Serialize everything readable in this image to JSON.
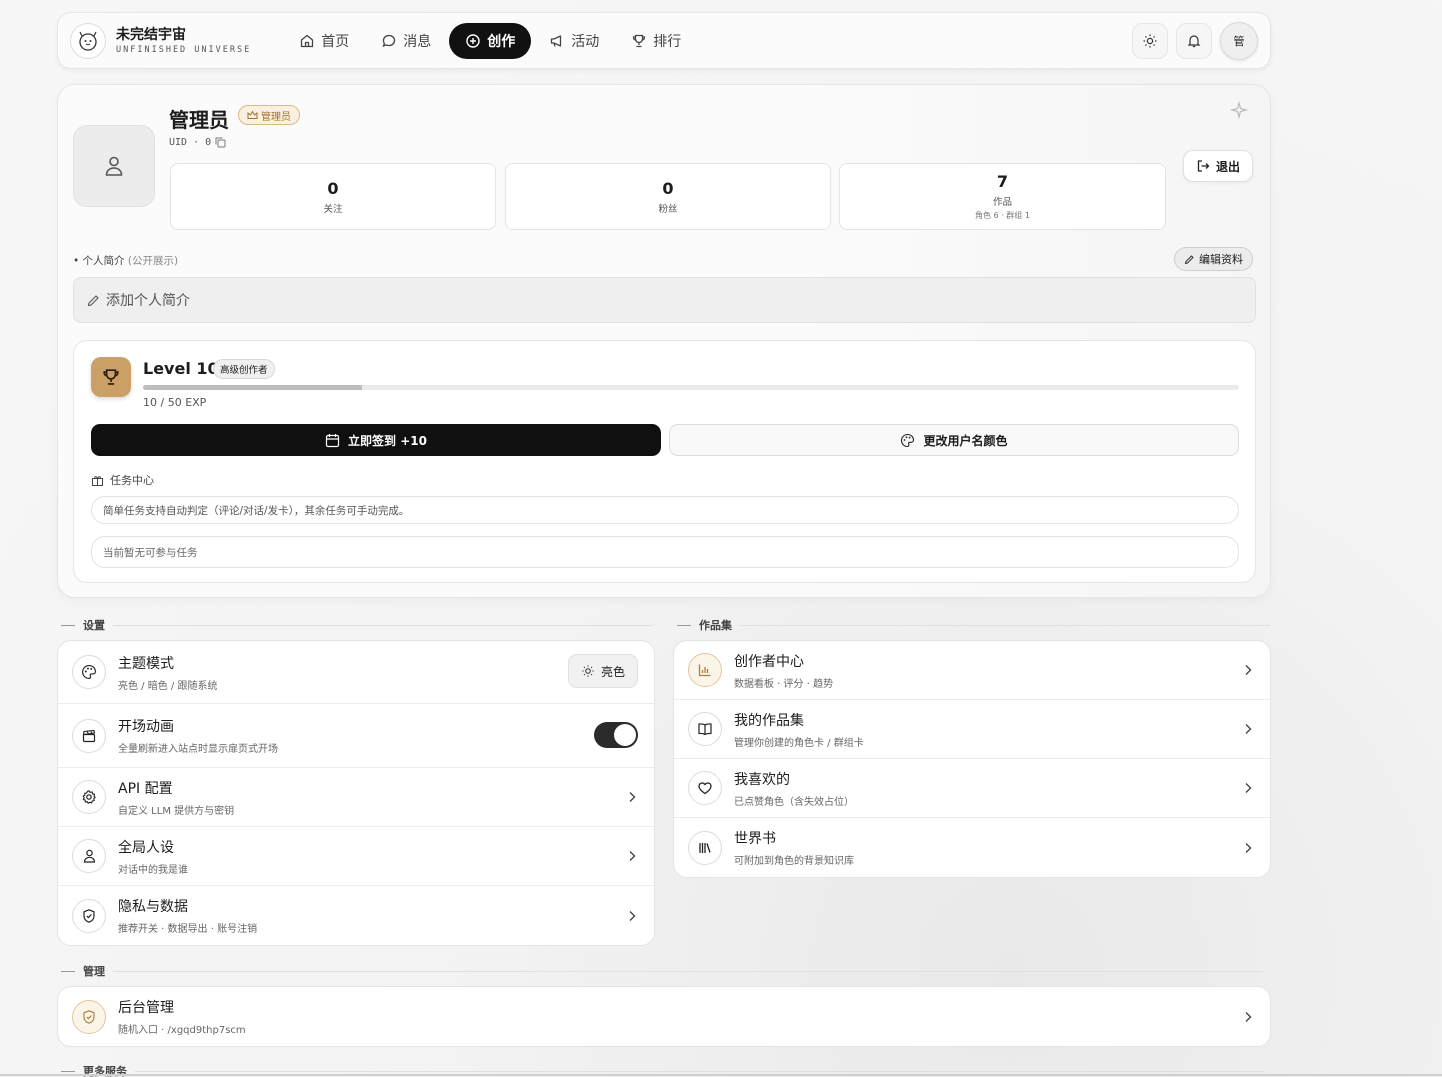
{
  "nav": {
    "brand_title": "未完结宇宙",
    "brand_subtitle": "UNFINISHED UNIVERSE",
    "items": [
      {
        "label": "首页",
        "icon": "home-icon"
      },
      {
        "label": "消息",
        "icon": "message-icon"
      },
      {
        "label": "创作",
        "icon": "plus-circle-icon",
        "active": true
      },
      {
        "label": "活动",
        "icon": "megaphone-icon"
      },
      {
        "label": "排行",
        "icon": "trophy-icon"
      }
    ],
    "avatar_text": "管"
  },
  "profile": {
    "username": "管理员",
    "badge": "管理员",
    "uid_text": "UID · 0",
    "stats": [
      {
        "value": "0",
        "label": "关注"
      },
      {
        "value": "0",
        "label": "粉丝"
      },
      {
        "value": "7",
        "label": "作品",
        "sub": "角色 6 · 群组 1"
      }
    ],
    "logout_label": "退出",
    "bio_label": "个人简介",
    "bio_label_muted": "(公开展示)",
    "edit_label": "编辑资料",
    "bio_placeholder": "添加个人简介"
  },
  "level": {
    "title": "Level 10",
    "badge": "高级创作者",
    "exp_text": "10 / 50 EXP",
    "exp_progress": 0.2,
    "checkin_label": "立即签到 +10",
    "color_label": "更改用户名颜色",
    "task_title": "任务中心",
    "task_note": "简单任务支持自动判定（评论/对话/发卡），其余任务可手动完成。",
    "task_empty": "当前暂无可参与任务"
  },
  "sections": {
    "settings": "设置",
    "works": "作品集",
    "admin": "管理",
    "more": "更多服务"
  },
  "settings": [
    {
      "title": "主题模式",
      "sub": "亮色 / 暗色 / 跟随系统",
      "icon": "palette-icon",
      "control": "亮色"
    },
    {
      "title": "开场动画",
      "sub": "全量刷新进入站点时显示扉页式开场",
      "icon": "clapper-icon",
      "toggle_on": true
    },
    {
      "title": "API 配置",
      "sub": "自定义 LLM 提供方与密钥",
      "icon": "gear-icon"
    },
    {
      "title": "全局人设",
      "sub": "对话中的我是谁",
      "icon": "user-icon"
    },
    {
      "title": "隐私与数据",
      "sub": "推荐开关 · 数据导出 · 账号注销",
      "icon": "shield-icon"
    }
  ],
  "works": [
    {
      "title": "创作者中心",
      "sub": "数据看板 · 评分 · 趋势",
      "icon": "chart-icon"
    },
    {
      "title": "我的作品集",
      "sub": "管理你创建的角色卡 / 群组卡",
      "icon": "book-icon"
    },
    {
      "title": "我喜欢的",
      "sub": "已点赞角色（含失效占位）",
      "icon": "heart-icon"
    },
    {
      "title": "世界书",
      "sub": "可附加到角色的背景知识库",
      "icon": "library-icon"
    }
  ],
  "admin": {
    "title": "后台管理",
    "sub": "随机入口 · /xgqd9thp7scm",
    "icon": "shield-check-icon"
  },
  "colors": {
    "accent_dark": "#111111",
    "gold": "#caa066"
  }
}
